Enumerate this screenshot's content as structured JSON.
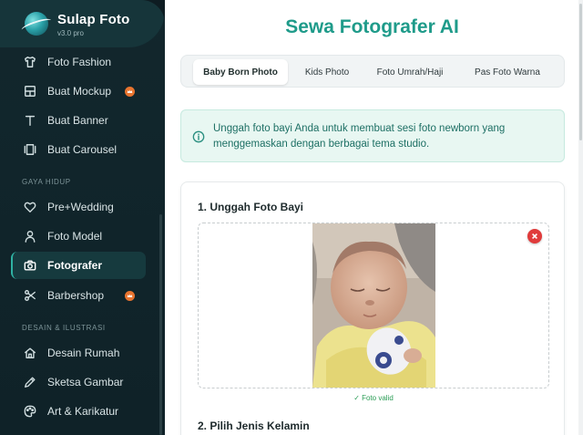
{
  "brand": {
    "name": "Sulap Foto",
    "version": "v3.0 pro"
  },
  "sidebar": {
    "items_top": [
      {
        "label": "Foto Fashion",
        "icon": "shirt-icon",
        "premium": false
      },
      {
        "label": "Buat Mockup",
        "icon": "mockup-icon",
        "premium": true
      },
      {
        "label": "Buat Banner",
        "icon": "text-icon",
        "premium": false
      },
      {
        "label": "Buat Carousel",
        "icon": "carousel-icon",
        "premium": false
      }
    ],
    "section_lifestyle": "GAYA HIDUP",
    "items_lifestyle": [
      {
        "label": "Pre+Wedding",
        "icon": "heart-icon",
        "premium": false
      },
      {
        "label": "Foto Model",
        "icon": "person-icon",
        "premium": false
      },
      {
        "label": "Fotografer",
        "icon": "camera-icon",
        "premium": false,
        "active": true
      },
      {
        "label": "Barbershop",
        "icon": "scissors-icon",
        "premium": true
      }
    ],
    "section_design": "DESAIN & ILUSTRASI",
    "items_design": [
      {
        "label": "Desain Rumah",
        "icon": "home-icon",
        "premium": false
      },
      {
        "label": "Sketsa Gambar",
        "icon": "pen-icon",
        "premium": false
      },
      {
        "label": "Art & Karikatur",
        "icon": "palette-icon",
        "premium": false
      }
    ]
  },
  "main": {
    "title": "Sewa Fotografer AI",
    "tabs": [
      {
        "label": "Baby Born Photo",
        "active": true
      },
      {
        "label": "Kids Photo",
        "active": false
      },
      {
        "label": "Foto Umrah/Haji",
        "active": false
      },
      {
        "label": "Pas Foto Warna",
        "active": false
      }
    ],
    "info_text": "Unggah foto bayi Anda untuk membuat sesi foto newborn yang menggemaskan dengan berbagai tema studio.",
    "upload_heading": "1. Unggah Foto Bayi",
    "valid_text": "✓ Foto valid",
    "gender_heading": "2. Pilih Jenis Kelamin"
  },
  "colors": {
    "accent": "#1f9b8a",
    "sidebar_bg": "#12272d",
    "premium": "#e8742f",
    "danger": "#e03b3b",
    "valid": "#2a9d55"
  }
}
